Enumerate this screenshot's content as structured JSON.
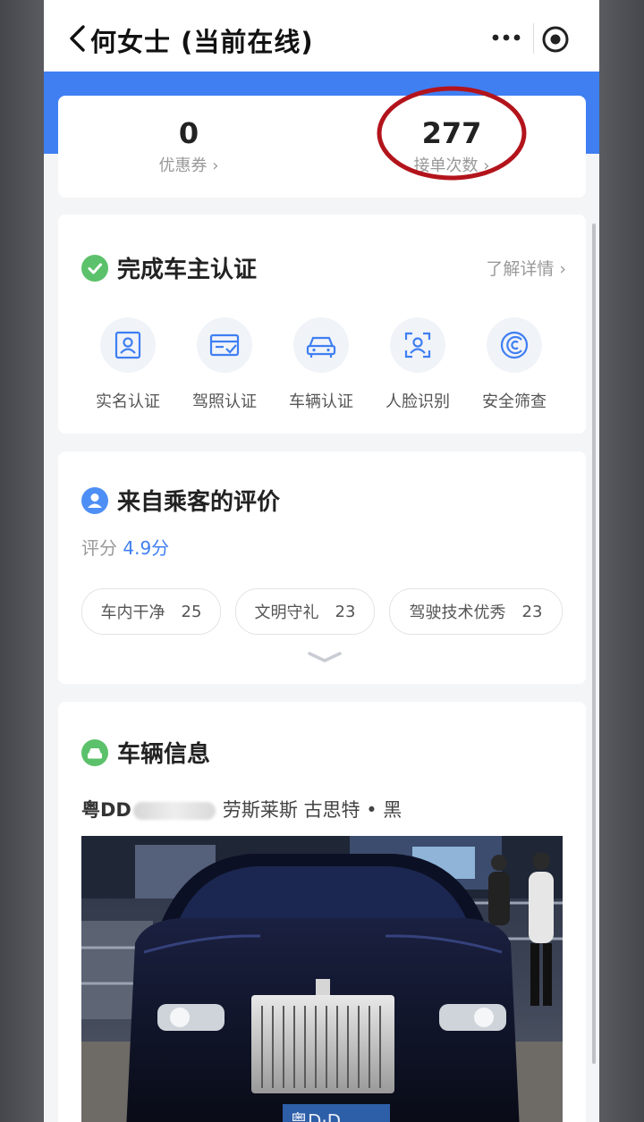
{
  "header": {
    "title": "何女士 (当前在线)"
  },
  "stats": [
    {
      "value": "0",
      "label": "优惠券 ›"
    },
    {
      "value": "277",
      "label": "接单次数 ›"
    }
  ],
  "verification": {
    "title": "完成车主认证",
    "detail_link": "了解详情 ›",
    "items": [
      {
        "label": "实名认证",
        "icon": "id-card-icon"
      },
      {
        "label": "驾照认证",
        "icon": "license-card-icon"
      },
      {
        "label": "车辆认证",
        "icon": "car-icon"
      },
      {
        "label": "人脸识别",
        "icon": "face-scan-icon"
      },
      {
        "label": "安全筛查",
        "icon": "security-scan-icon"
      }
    ]
  },
  "reviews": {
    "title": "来自乘客的评价",
    "score_label": "评分",
    "score_value": "4.9分",
    "tags": [
      {
        "label": "车内干净",
        "count": "25"
      },
      {
        "label": "文明守礼",
        "count": "23"
      },
      {
        "label": "驾驶技术优秀",
        "count": "23"
      }
    ]
  },
  "vehicle": {
    "title": "车辆信息",
    "plate_prefix": "粤DD",
    "description": "劳斯莱斯 古思特 • 黑",
    "photo_plate_text": "粤D·D"
  },
  "colors": {
    "accent_blue": "#3f7ff2",
    "verify_green": "#5cc16b",
    "highlight_circle": "#b3141c"
  }
}
